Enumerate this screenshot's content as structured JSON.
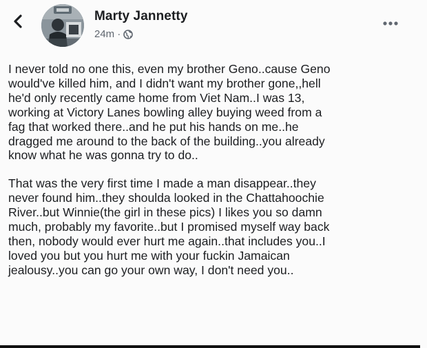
{
  "post": {
    "author": "Marty Jannetty",
    "time": "24m",
    "separator": "·",
    "visibility_icon": "globe-icon",
    "paragraphs": [
      "I never told no one this, even my brother Geno..cause Geno\nwould've killed him, and I didn't want my brother gone,,hell\nhe'd only recently came home from Viet Nam..I was 13,\nworking at Victory Lanes bowling alley buying weed from a\nfag that worked there..and he put his hands on me..he\ndragged me around to the back of the building..you already\nknow what he was gonna try to do..",
      "That was the very first time I made a man disappear..they\nnever found him..they shoulda looked in the Chattahoochie\nRiver..but Winnie(the girl in these pics) I likes you so damn\nmuch, probably my favorite..but I promised myself way back\nthen, nobody would ever hurt me again..that includes you..I\nloved you but you hurt me with your fuckin Jamaican\njealousy..you can go your own way, I don't need you.."
    ]
  },
  "icons": {
    "back": "chevron-left-icon",
    "more": "more-options-icon",
    "avatar": "profile-picture"
  },
  "colors": {
    "background": "#fbfbfb",
    "text": "#1c1e21",
    "meta": "#606770"
  }
}
